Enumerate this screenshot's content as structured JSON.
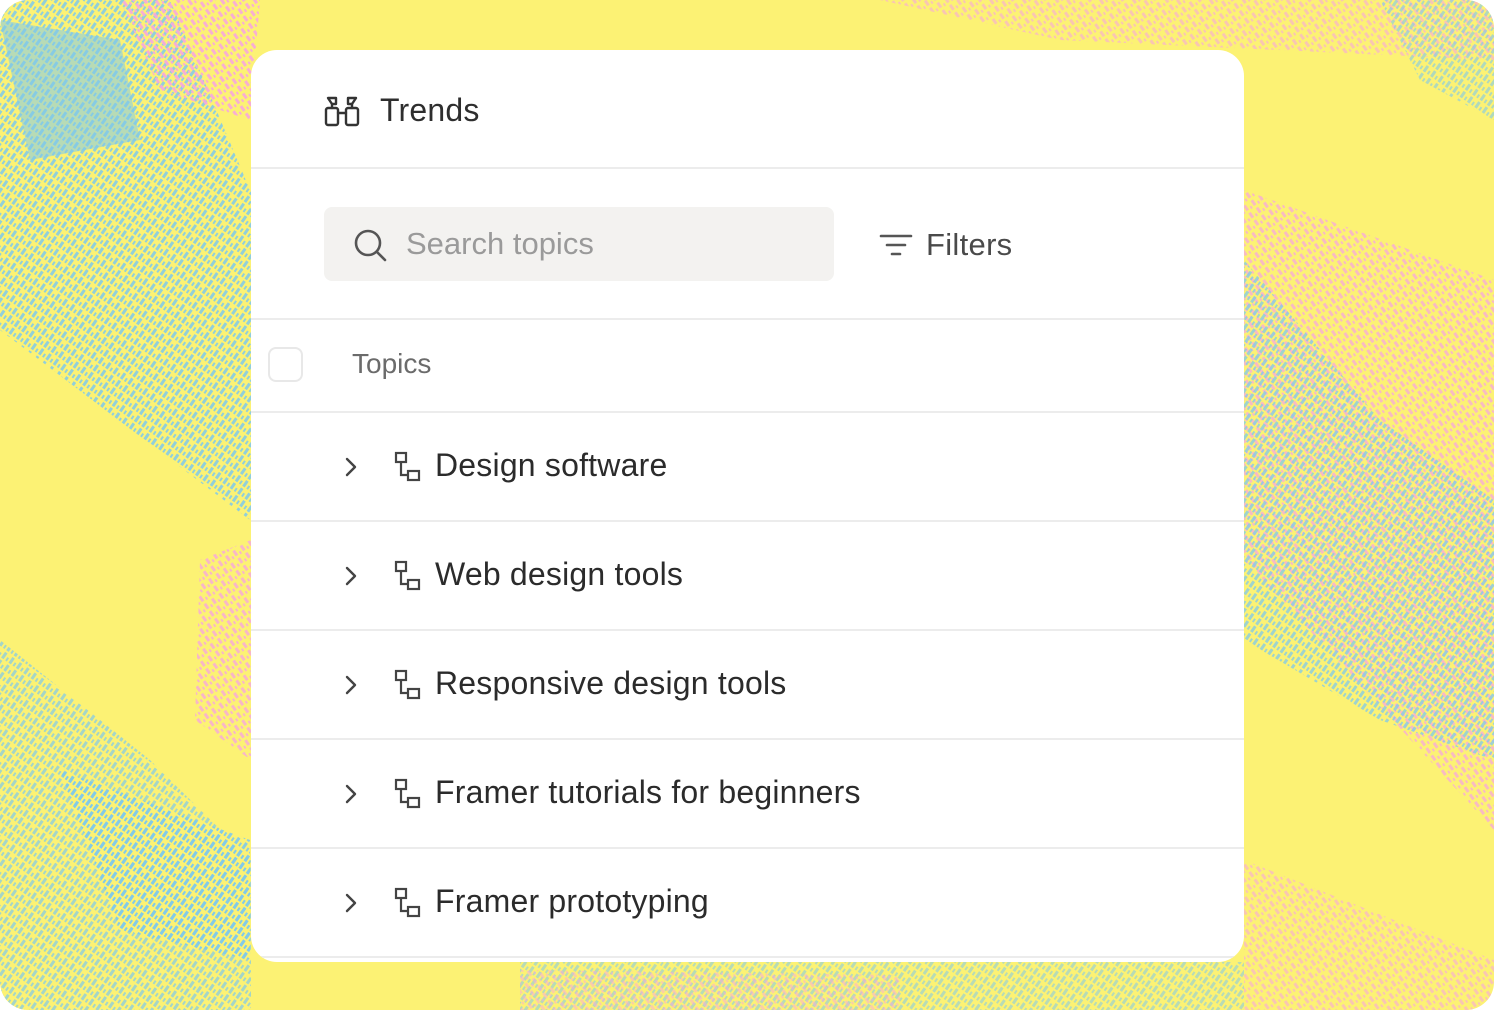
{
  "header": {
    "title": "Trends",
    "icon": "binoculars-icon"
  },
  "search": {
    "placeholder": "Search topics",
    "value": "",
    "icon": "search-icon"
  },
  "filters": {
    "label": "Filters",
    "icon": "filter-icon"
  },
  "table": {
    "column_label": "Topics",
    "select_all_checked": false
  },
  "topics": [
    {
      "label": "Design software"
    },
    {
      "label": "Web design tools"
    },
    {
      "label": "Responsive design tools"
    },
    {
      "label": "Framer tutorials for beginners"
    },
    {
      "label": "Framer prototyping"
    }
  ],
  "colors": {
    "background_yellow": "#fcf274",
    "accent_blue": "#7ec9ec",
    "accent_pink": "#f7a8dc"
  }
}
